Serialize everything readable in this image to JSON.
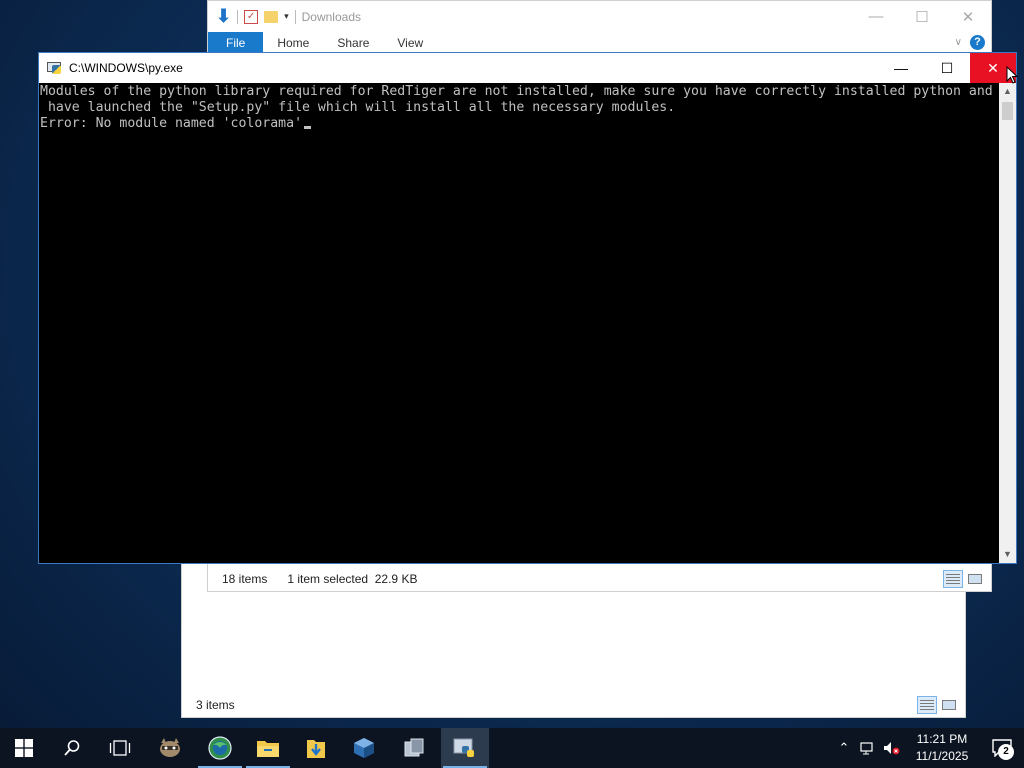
{
  "explorer_back": {
    "status_items": "3 items"
  },
  "explorer_front": {
    "title": "Downloads",
    "ribbon_tabs": [
      "File",
      "Home",
      "Share",
      "View"
    ],
    "status_items": "18 items",
    "status_selected": "1 item selected",
    "status_size": "22.9 KB",
    "help_label": "?"
  },
  "console": {
    "title": "C:\\WINDOWS\\py.exe",
    "lines": [
      "Modules of the python library required for RedTiger are not installed, make sure you have correctly installed python and",
      " have launched the \"Setup.py\" file which will install all the necessary modules.",
      "Error: No module named 'colorama'"
    ],
    "close_color": "#e81123"
  },
  "taskbar": {
    "clock_time": "11:21 PM",
    "clock_date": "11/1/2025",
    "notification_count": "2",
    "accent": "#78b2e6"
  }
}
